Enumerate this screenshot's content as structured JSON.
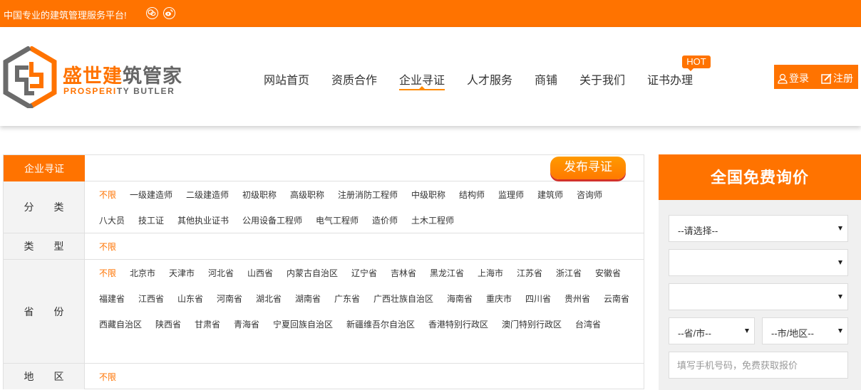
{
  "topbar": {
    "slogan": "中国专业的建筑管理服务平台!",
    "icons": [
      "wechat-icon",
      "weibo-icon"
    ]
  },
  "brand": {
    "name_orange": "盛世建",
    "name_gray": "筑管家",
    "en_orange": "PROSPERI",
    "en_gray": "TY BUTLER",
    "colors": {
      "primary": "#ff7300",
      "secondary": "#666666"
    }
  },
  "nav": {
    "items": [
      {
        "label": "网站首页",
        "active": false
      },
      {
        "label": "资质合作",
        "active": false
      },
      {
        "label": "企业寻证",
        "active": true
      },
      {
        "label": "人才服务",
        "active": false
      },
      {
        "label": "商铺",
        "active": false
      },
      {
        "label": "关于我们",
        "active": false
      },
      {
        "label": "证书办理",
        "active": false
      }
    ],
    "hot_badge": "HOT"
  },
  "auth": {
    "login": "登录",
    "register": "注册"
  },
  "filter": {
    "tab": "企业寻证",
    "publish_button": "发布寻证",
    "rows": [
      {
        "label": [
          "分",
          "类"
        ],
        "options": [
          "不限",
          "一级建造师",
          "二级建造师",
          "初级职称",
          "高级职称",
          "注册消防工程师",
          "中级职称",
          "结构师",
          "监理师",
          "建筑师",
          "咨询师",
          "八大员",
          "技工证",
          "其他执业证书",
          "公用设备工程师",
          "电气工程师",
          "造价师",
          "土木工程师"
        ],
        "selected": "不限"
      },
      {
        "label": [
          "类",
          "型"
        ],
        "options": [
          "不限"
        ],
        "selected": "不限"
      },
      {
        "label": [
          "省",
          "份"
        ],
        "options": [
          "不限",
          "北京市",
          "天津市",
          "河北省",
          "山西省",
          "内蒙古自治区",
          "辽宁省",
          "吉林省",
          "黑龙江省",
          "上海市",
          "江苏省",
          "浙江省",
          "安徽省",
          "福建省",
          "江西省",
          "山东省",
          "河南省",
          "湖北省",
          "湖南省",
          "广东省",
          "广西壮族自治区",
          "海南省",
          "重庆市",
          "四川省",
          "贵州省",
          "云南省",
          "西藏自治区",
          "陕西省",
          "甘肃省",
          "青海省",
          "宁夏回族自治区",
          "新疆维吾尔自治区",
          "香港特别行政区",
          "澳门特别行政区",
          "台湾省"
        ],
        "selected": "不限"
      },
      {
        "label": [
          "地",
          "区"
        ],
        "options": [
          "不限"
        ],
        "selected": "不限"
      }
    ]
  },
  "inquiry": {
    "title": "全国免费询价",
    "select1": "--请选择--",
    "select2": "",
    "select3": "",
    "province": "--省/市--",
    "city": "--市/地区--",
    "phone_placeholder": "填写手机号码，免费获取报价"
  }
}
